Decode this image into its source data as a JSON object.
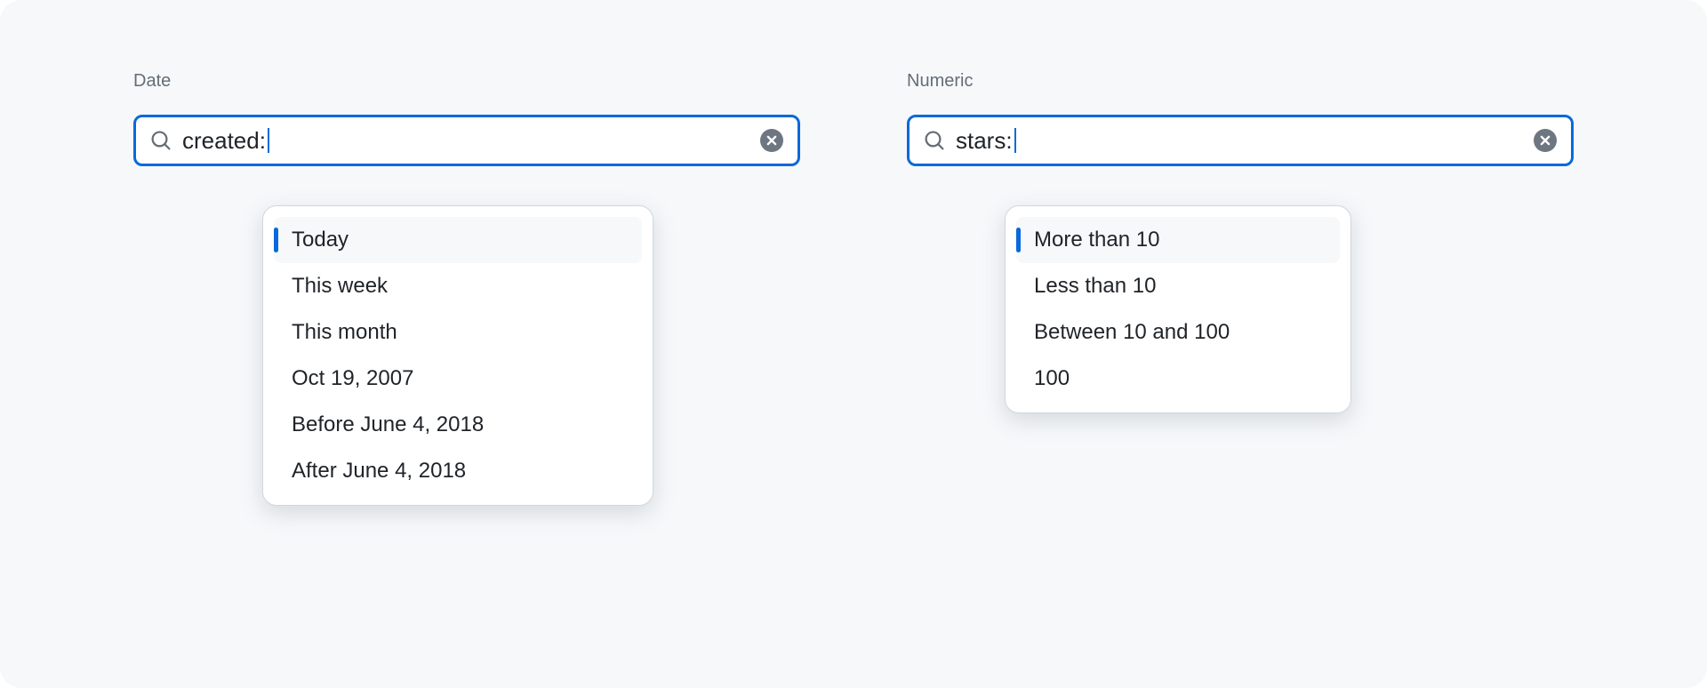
{
  "date_panel": {
    "label": "Date",
    "search_value": "created:",
    "items": [
      {
        "label": "Today"
      },
      {
        "label": "This week"
      },
      {
        "label": "This month"
      },
      {
        "label": "Oct 19, 2007"
      },
      {
        "label": "Before June 4, 2018"
      },
      {
        "label": "After June 4, 2018"
      }
    ]
  },
  "numeric_panel": {
    "label": "Numeric",
    "search_value": "stars:",
    "items": [
      {
        "label": "More than 10"
      },
      {
        "label": "Less than 10"
      },
      {
        "label": "Between 10 and 100"
      },
      {
        "label": "100"
      }
    ]
  }
}
